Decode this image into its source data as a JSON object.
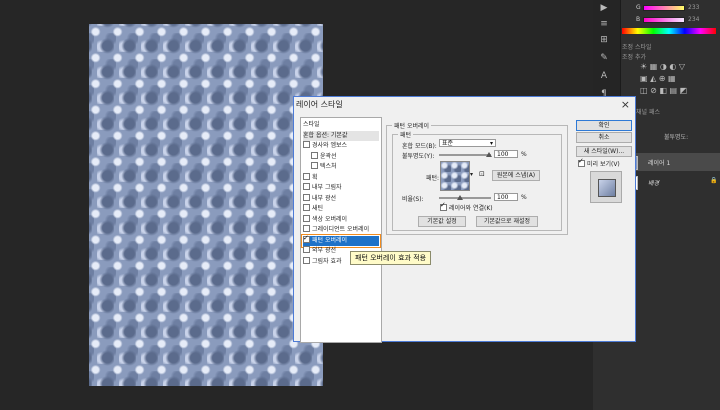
{
  "dialog": {
    "title": "레이어 스타일",
    "close": "×",
    "style_list": [
      {
        "label": "스타일",
        "checkbox": false,
        "checked": false,
        "indent": 0
      },
      {
        "label": "혼합 옵션: 기본값",
        "checkbox": false,
        "checked": false,
        "indent": 0
      },
      {
        "label": "경사와 엠보스",
        "checkbox": true,
        "checked": false,
        "indent": 0
      },
      {
        "label": "윤곽선",
        "checkbox": true,
        "checked": false,
        "indent": 1
      },
      {
        "label": "텍스처",
        "checkbox": true,
        "checked": false,
        "indent": 1
      },
      {
        "label": "획",
        "checkbox": true,
        "checked": false,
        "indent": 0
      },
      {
        "label": "내부 그림자",
        "checkbox": true,
        "checked": false,
        "indent": 0
      },
      {
        "label": "내부 광선",
        "checkbox": true,
        "checked": false,
        "indent": 0
      },
      {
        "label": "새틴",
        "checkbox": true,
        "checked": false,
        "indent": 0
      },
      {
        "label": "색상 오버레이",
        "checkbox": true,
        "checked": false,
        "indent": 0
      },
      {
        "label": "그레이디언트 오버레이",
        "checkbox": true,
        "checked": false,
        "indent": 0
      },
      {
        "label": "패턴 오버레이",
        "checkbox": true,
        "checked": true,
        "indent": 0,
        "selected": true
      },
      {
        "label": "외부 광선",
        "checkbox": true,
        "checked": false,
        "indent": 0
      },
      {
        "label": "그림자 효과",
        "checkbox": true,
        "checked": false,
        "indent": 0
      }
    ],
    "panel": {
      "group_title": "패턴 오버레이",
      "sub_title": "패턴",
      "blend_mode_label": "혼합 모드(B):",
      "blend_mode_value": "표준",
      "opacity_label": "불투명도(Y):",
      "opacity_value": "100",
      "opacity_unit": "%",
      "pattern_label": "패턴:",
      "snap_button": "원본에 스냅(A)",
      "scale_label": "비율(S):",
      "scale_value": "100",
      "scale_unit": "%",
      "link_label": "레이어와 연결(K)",
      "link_checked": true,
      "default_button": "기본값 설정",
      "reset_button": "기본값으로 재설정"
    },
    "buttons": {
      "ok": "확인",
      "cancel": "취소",
      "new_style": "새 스타일(W)...",
      "preview_label": "미리 보기(V)",
      "preview_checked": true
    },
    "tooltip": "패턴 오버레이 효과 적용"
  },
  "right_panel": {
    "g_label": "G",
    "g_value": "233",
    "b_label": "B",
    "b_value": "234",
    "tabs": "조정 스타일",
    "add_adjust": "조정 추가",
    "layers_tabs": "채널 패스",
    "opacity_label": "불투명도:",
    "layers": [
      {
        "name": "레이어 1"
      },
      {
        "name": "배경"
      }
    ]
  }
}
